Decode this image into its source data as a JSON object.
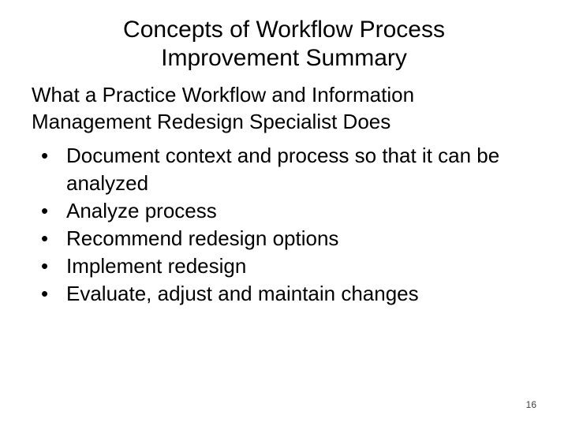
{
  "slide": {
    "title": "Concepts of Workflow Process Improvement Summary",
    "subtitle": "What a Practice Workflow and Information Management Redesign Specialist Does",
    "bullets": [
      "Document context and process so that it can be analyzed",
      "Analyze process",
      "Recommend redesign options",
      "Implement redesign",
      "Evaluate, adjust and maintain changes"
    ],
    "page_number": "16"
  }
}
